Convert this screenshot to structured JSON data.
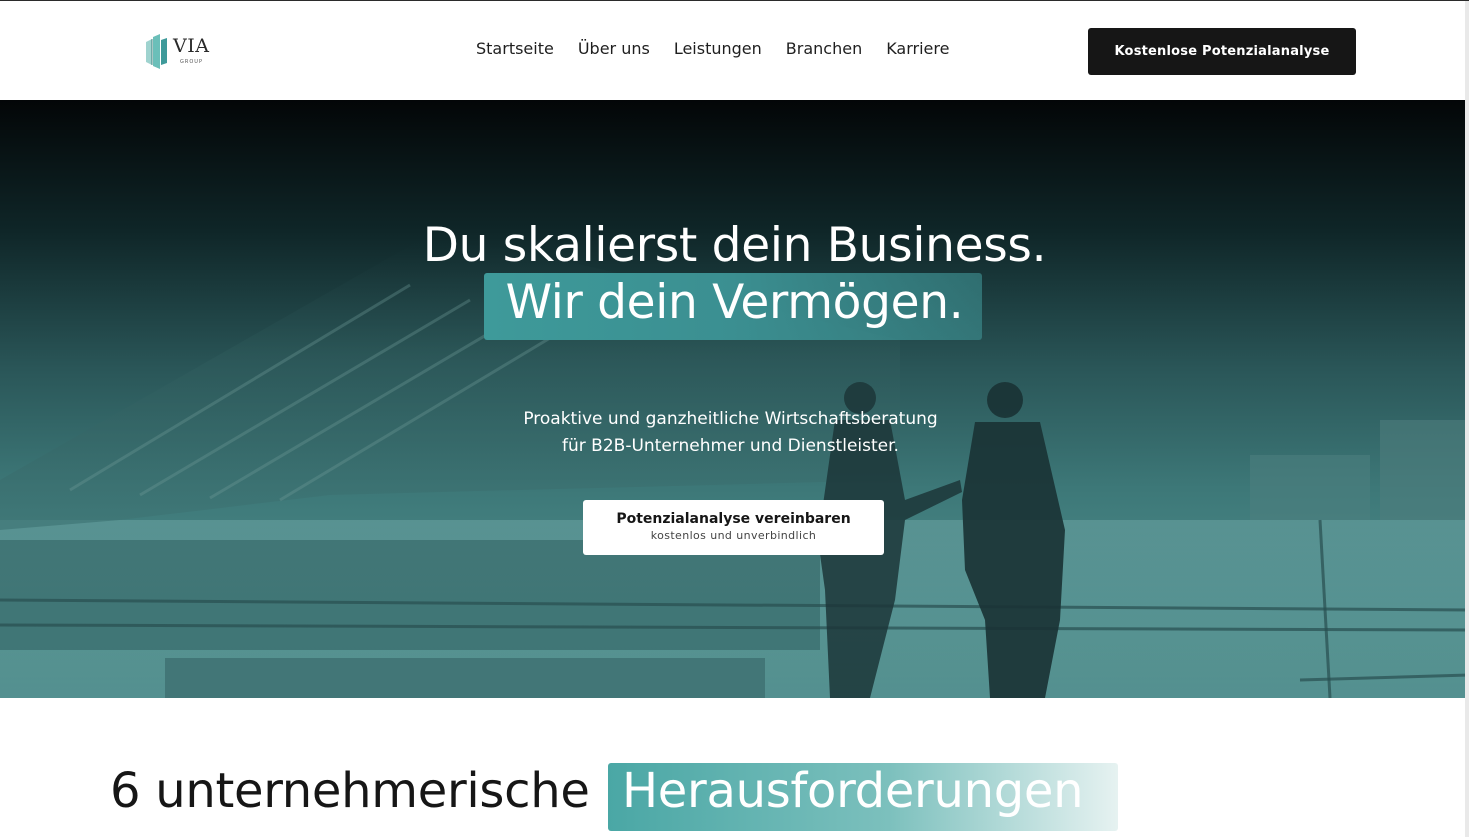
{
  "brand": {
    "name": "VIA",
    "sub": "GROUP",
    "accent": "#3e9a9a"
  },
  "nav": {
    "items": [
      "Startseite",
      "Über uns",
      "Leistungen",
      "Branchen",
      "Karriere"
    ],
    "cta_label": "Kostenlose Potenzialanalyse"
  },
  "hero": {
    "title_line1": "Du skalierst dein Business.",
    "title_line2": "Wir dein Vermögen.",
    "subtitle_line1": "Proaktive und ganzheitliche Wirtschaftsberatung",
    "subtitle_line2": "für B2B-Unternehmer und Dienstleister.",
    "cta_main": "Potenzialanalyse vereinbaren",
    "cta_sub": "kostenlos und unverbindlich"
  },
  "section": {
    "title_plain": "6 unternehmerische",
    "title_highlight": "Herausforderungen"
  },
  "icons": {
    "logo": "via-group-logo-icon"
  }
}
